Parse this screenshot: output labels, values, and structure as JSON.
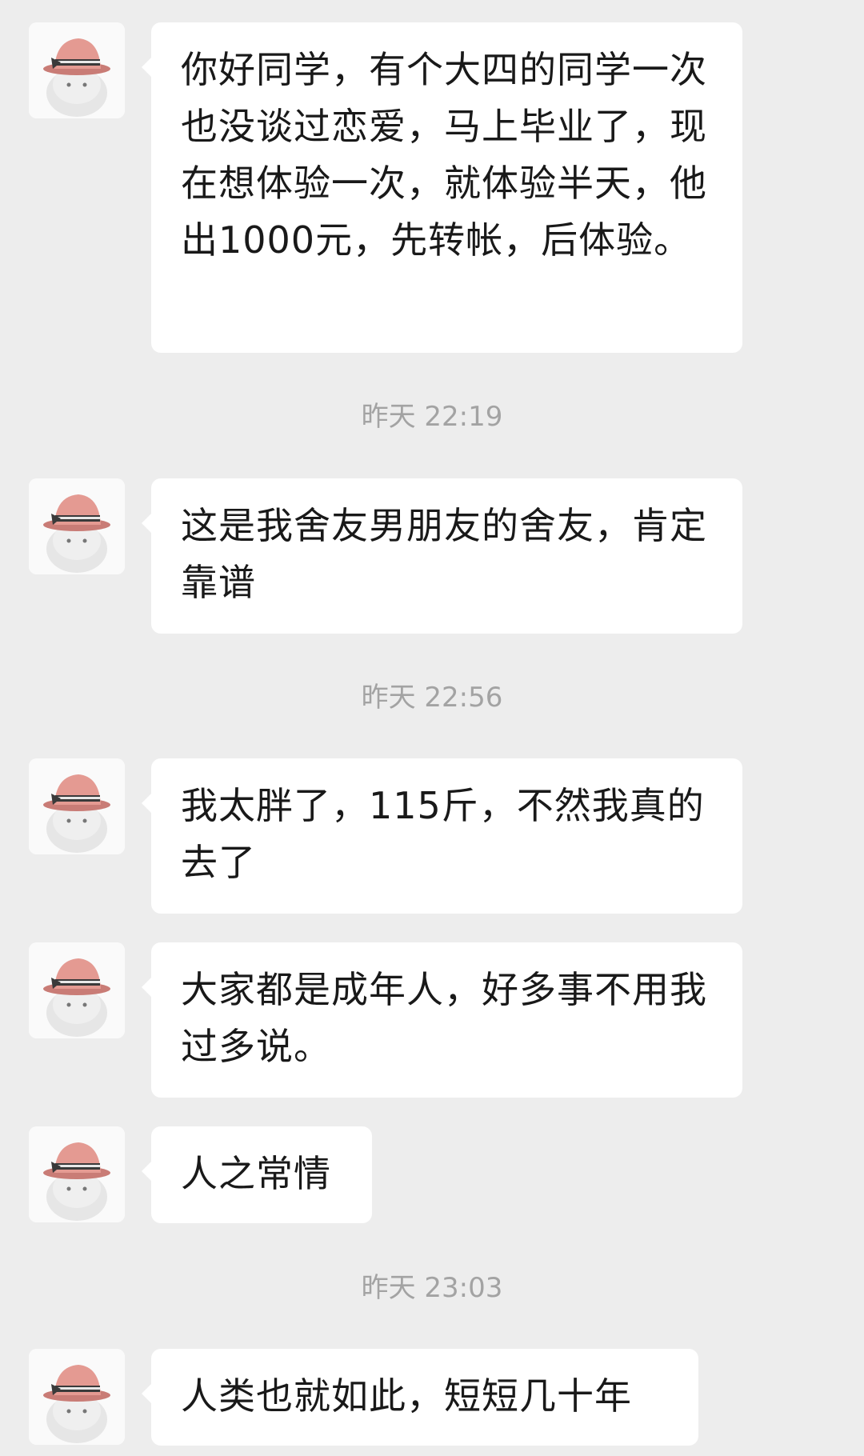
{
  "chat": {
    "sender_avatar": "cat-with-pink-hat-avatar",
    "messages": [
      {
        "text": "你好同学，有个大四的同学一次也没谈过恋爱，马上毕业了，现在想体验一次，就体验半天，他出1000元，先转帐，后体验。"
      },
      {
        "text": "这是我舍友男朋友的舍友，肯定靠谱"
      },
      {
        "text": "我太胖了，115斤，不然我真的去了"
      },
      {
        "text": "大家都是成年人，好多事不用我过多说。"
      },
      {
        "text": "人之常情"
      },
      {
        "text": "人类也就如此，短短几十年"
      }
    ],
    "timestamps": [
      "昨天 22:19",
      "昨天 22:56",
      "昨天 23:03"
    ]
  },
  "colors": {
    "background": "#ededed",
    "bubble": "#ffffff",
    "text": "#191919",
    "timestamp": "#a3a3a3"
  }
}
